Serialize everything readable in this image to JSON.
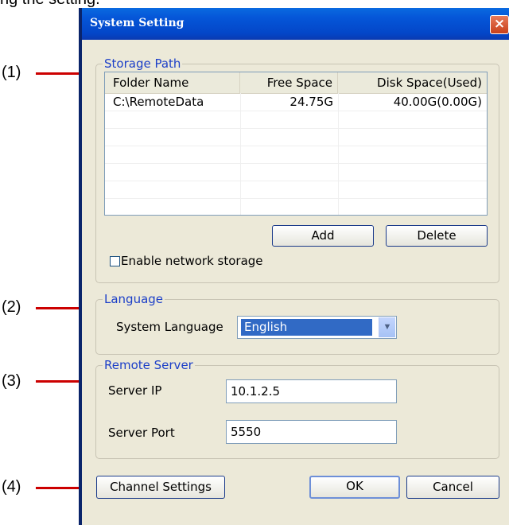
{
  "page_caption": "ng the setting.",
  "callouts": [
    "(1)",
    "(2)",
    "(3)",
    "(4)"
  ],
  "window": {
    "title": "System Setting",
    "close_glyph": "×"
  },
  "storage": {
    "group_label": "Storage Path",
    "columns": [
      "Folder Name",
      "Free Space",
      "Disk Space(Used)"
    ],
    "rows": [
      {
        "folder": "C:\\RemoteData",
        "free": "24.75G",
        "disk": "40.00G(0.00G)"
      }
    ],
    "add_label": "Add",
    "delete_label": "Delete",
    "network_label": "Enable network storage",
    "network_checked": false
  },
  "language": {
    "group_label": "Language",
    "field_label": "System Language",
    "selected": "English"
  },
  "remote": {
    "group_label": "Remote Server",
    "ip_label": "Server IP",
    "ip_value": "10.1.2.5",
    "port_label": "Server Port",
    "port_value": "5550"
  },
  "footer": {
    "channel_label": "Channel Settings",
    "ok_label": "OK",
    "cancel_label": "Cancel"
  },
  "icons": {
    "dropdown": "chevron-down-icon",
    "close": "close-icon"
  },
  "colors": {
    "callout_line": "#cc0000",
    "group_label": "#1c3fc8",
    "title_bar": "#0556d8",
    "selection": "#316ac5"
  }
}
